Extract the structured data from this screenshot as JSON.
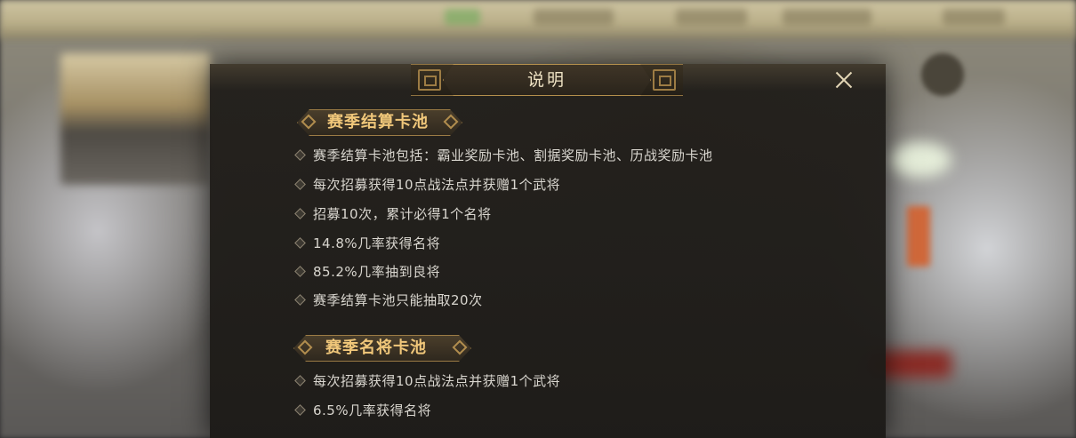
{
  "dialog": {
    "title": "说明",
    "close_icon": "close-icon"
  },
  "sections": [
    {
      "header": "赛季结算卡池",
      "items": [
        "赛季结算卡池包括：霸业奖励卡池、割据奖励卡池、历战奖励卡池",
        "每次招募获得10点战法点并获赠1个武将",
        "招募10次，累计必得1个名将",
        "14.8%几率获得名将",
        "85.2%几率抽到良将",
        "赛季结算卡池只能抽取20次"
      ]
    },
    {
      "header": "赛季名将卡池",
      "items": [
        "每次招募获得10点战法点并获赠1个武将",
        "6.5%几率获得名将"
      ]
    }
  ],
  "colors": {
    "panel_bg": "#221f1b",
    "gold_border": "#b48f4c",
    "section_title": "#f0c77a",
    "body_text": "#d9d6cf",
    "title_text": "#efe3c4"
  }
}
